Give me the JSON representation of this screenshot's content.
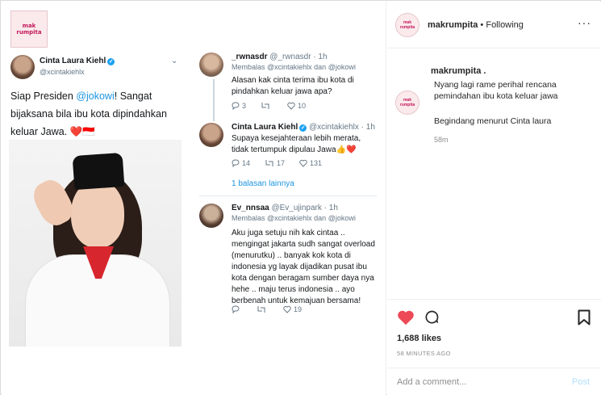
{
  "post_image": {
    "logo_text": "mak rumpita",
    "main_tweet": {
      "name": "Cinta Laura Kiehl",
      "handle": "@xcintakiehlx",
      "text_before": "Siap Presiden ",
      "mention": "@jokowi",
      "text_after": "! Sangat bijaksana bila ibu kota dipindahkan keluar Jawa. ❤️🇮🇩"
    },
    "replies": [
      {
        "name": "_rwnasdr",
        "meta": "@_rwnasdr · 1h",
        "replying_to": "Membalas @xcintakiehlx dan @jokowi",
        "text": "Alasan kak cinta terima ibu kota di pindahkan keluar jawa apa?",
        "reply_count": "3",
        "retweet_count": "",
        "like_count": "10"
      },
      {
        "name": "Cinta Laura Kiehl",
        "meta": "@xcintakiehlx · 1h",
        "replying_to": "",
        "text": "Supaya kesejahteraan lebih merata, tidak tertumpuk dipulau Jawa👍❤️",
        "reply_count": "14",
        "retweet_count": "17",
        "like_count": "131"
      },
      {
        "name": "Ev_nnsaa",
        "meta": "@Ev_ujinpark · 1h",
        "replying_to": "Membalas @xcintakiehlx dan @jokowi",
        "text": "Aku juga setuju nih kak cintaa .. mengingat jakarta sudh sangat overload (menurutku) .. banyak kok kota di indonesia yg layak dijadikan pusat ibu kota dengan beragam sumber daya nya hehe .. maju terus indonesia .. ayo berbenah untuk kemajuan bersama!",
        "reply_count": "",
        "retweet_count": "",
        "like_count": "19"
      }
    ],
    "more_replies": "1 balasan lainnya"
  },
  "header": {
    "username": "makrumpita",
    "separator": "•",
    "follow_status": "Following",
    "more": "···"
  },
  "caption": {
    "username": "makrumpita .",
    "text": "Nyang lagi rame perihal rencana pemindahan ibu kota keluar jawa",
    "text2": "Begindang menurut Cinta laura",
    "time": "58m"
  },
  "stats": {
    "likes": "1,688 likes",
    "posted": "58 MINUTES AGO"
  },
  "comment_box": {
    "placeholder": "Add a comment...",
    "post_label": "Post"
  },
  "colors": {
    "like_red": "#ed4956",
    "twitter_blue": "#1b95e0",
    "brand_pink": "#c2185b"
  }
}
